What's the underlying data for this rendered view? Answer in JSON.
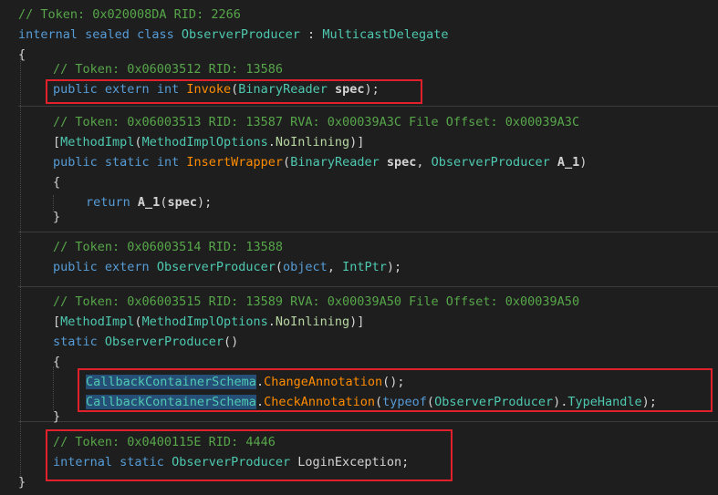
{
  "colors": {
    "comment": "#57a64a",
    "keyword": "#569cd6",
    "type": "#4ec9b0",
    "method": "#ff8c00",
    "plain": "#d4d4d4",
    "enum_member": "#b8d7a3",
    "background": "#1e1e1e",
    "selection": "#264f78",
    "annotation_box": "#e0202a"
  },
  "code": {
    "lines": [
      {
        "indent": 0,
        "tokens": [
          {
            "t": "// Token: 0x020008DA RID: 2266",
            "c": "comment"
          }
        ]
      },
      {
        "indent": 0,
        "tokens": [
          {
            "t": "internal",
            "c": "keyword"
          },
          {
            "t": " "
          },
          {
            "t": "sealed",
            "c": "keyword"
          },
          {
            "t": " "
          },
          {
            "t": "class",
            "c": "keyword"
          },
          {
            "t": " "
          },
          {
            "t": "ObserverProducer",
            "c": "type"
          },
          {
            "t": " : "
          },
          {
            "t": "MulticastDelegate",
            "c": "type"
          }
        ]
      },
      {
        "indent": 0,
        "tokens": [
          {
            "t": "{"
          }
        ]
      },
      {
        "indent": 1,
        "tokens": [
          {
            "t": "// Token: 0x06003512 RID: 13586",
            "c": "comment"
          }
        ]
      },
      {
        "indent": 1,
        "tokens": [
          {
            "t": "public",
            "c": "keyword"
          },
          {
            "t": " "
          },
          {
            "t": "extern",
            "c": "keyword"
          },
          {
            "t": " "
          },
          {
            "t": "int",
            "c": "keyword"
          },
          {
            "t": " "
          },
          {
            "t": "Invoke",
            "c": "method"
          },
          {
            "t": "("
          },
          {
            "t": "BinaryReader",
            "c": "type"
          },
          {
            "t": " "
          },
          {
            "t": "spec",
            "b": true
          },
          {
            "t": ");"
          }
        ]
      },
      {
        "indent": 1,
        "tokens": [
          {
            "t": "// Token: 0x06003513 RID: 13587 RVA: 0x00039A3C File Offset: 0x00039A3C",
            "c": "comment"
          }
        ]
      },
      {
        "indent": 1,
        "tokens": [
          {
            "t": "["
          },
          {
            "t": "MethodImpl",
            "c": "type"
          },
          {
            "t": "("
          },
          {
            "t": "MethodImplOptions",
            "c": "type"
          },
          {
            "t": "."
          },
          {
            "t": "NoInlining",
            "c": "enum_member"
          },
          {
            "t": ")]"
          }
        ]
      },
      {
        "indent": 1,
        "tokens": [
          {
            "t": "public",
            "c": "keyword"
          },
          {
            "t": " "
          },
          {
            "t": "static",
            "c": "keyword"
          },
          {
            "t": " "
          },
          {
            "t": "int",
            "c": "keyword"
          },
          {
            "t": " "
          },
          {
            "t": "InsertWrapper",
            "c": "method"
          },
          {
            "t": "("
          },
          {
            "t": "BinaryReader",
            "c": "type"
          },
          {
            "t": " "
          },
          {
            "t": "spec",
            "b": true
          },
          {
            "t": ", "
          },
          {
            "t": "ObserverProducer",
            "c": "type"
          },
          {
            "t": " "
          },
          {
            "t": "A_1",
            "b": true
          },
          {
            "t": ")"
          }
        ]
      },
      {
        "indent": 1,
        "tokens": [
          {
            "t": "{"
          }
        ]
      },
      {
        "indent": 2,
        "tokens": [
          {
            "t": "return",
            "c": "keyword"
          },
          {
            "t": " "
          },
          {
            "t": "A_1",
            "b": true
          },
          {
            "t": "("
          },
          {
            "t": "spec",
            "b": true
          },
          {
            "t": ");"
          }
        ]
      },
      {
        "indent": 1,
        "tokens": [
          {
            "t": "}"
          }
        ]
      },
      {
        "indent": 1,
        "tokens": [
          {
            "t": "// Token: 0x06003514 RID: 13588",
            "c": "comment"
          }
        ]
      },
      {
        "indent": 1,
        "tokens": [
          {
            "t": "public",
            "c": "keyword"
          },
          {
            "t": " "
          },
          {
            "t": "extern",
            "c": "keyword"
          },
          {
            "t": " "
          },
          {
            "t": "ObserverProducer",
            "c": "type"
          },
          {
            "t": "("
          },
          {
            "t": "object",
            "c": "keyword"
          },
          {
            "t": ", "
          },
          {
            "t": "IntPtr",
            "c": "type"
          },
          {
            "t": ");"
          }
        ]
      },
      {
        "indent": 1,
        "tokens": [
          {
            "t": "// Token: 0x06003515 RID: 13589 RVA: 0x00039A50 File Offset: 0x00039A50",
            "c": "comment"
          }
        ]
      },
      {
        "indent": 1,
        "tokens": [
          {
            "t": "["
          },
          {
            "t": "MethodImpl",
            "c": "type"
          },
          {
            "t": "("
          },
          {
            "t": "MethodImplOptions",
            "c": "type"
          },
          {
            "t": "."
          },
          {
            "t": "NoInlining",
            "c": "enum_member"
          },
          {
            "t": ")]"
          }
        ]
      },
      {
        "indent": 1,
        "tokens": [
          {
            "t": "static",
            "c": "keyword"
          },
          {
            "t": " "
          },
          {
            "t": "ObserverProducer",
            "c": "type"
          },
          {
            "t": "()"
          }
        ]
      },
      {
        "indent": 1,
        "tokens": [
          {
            "t": "{"
          }
        ]
      },
      {
        "indent": 2,
        "tokens": [
          {
            "t": "CallbackContainerSchema",
            "c": "type",
            "hl": true
          },
          {
            "t": "."
          },
          {
            "t": "ChangeAnnotation",
            "c": "method"
          },
          {
            "t": "();"
          }
        ]
      },
      {
        "indent": 2,
        "tokens": [
          {
            "t": "CallbackContainerSchema",
            "c": "type",
            "hl": true
          },
          {
            "t": "."
          },
          {
            "t": "CheckAnnotation",
            "c": "method"
          },
          {
            "t": "("
          },
          {
            "t": "typeof",
            "c": "keyword"
          },
          {
            "t": "("
          },
          {
            "t": "ObserverProducer",
            "c": "type"
          },
          {
            "t": ")."
          },
          {
            "t": "TypeHandle",
            "c": "type"
          },
          {
            "t": ");"
          }
        ]
      },
      {
        "indent": 1,
        "tokens": [
          {
            "t": "}"
          }
        ]
      },
      {
        "indent": 1,
        "tokens": [
          {
            "t": "// Token: 0x0400115E RID: 4446",
            "c": "comment"
          }
        ]
      },
      {
        "indent": 1,
        "tokens": [
          {
            "t": "internal",
            "c": "keyword"
          },
          {
            "t": " "
          },
          {
            "t": "static",
            "c": "keyword"
          },
          {
            "t": " "
          },
          {
            "t": "ObserverProducer",
            "c": "type"
          },
          {
            "t": " "
          },
          {
            "t": "LoginException"
          },
          {
            "t": ";"
          }
        ]
      },
      {
        "indent": 0,
        "tokens": [
          {
            "t": "}"
          }
        ]
      }
    ]
  }
}
